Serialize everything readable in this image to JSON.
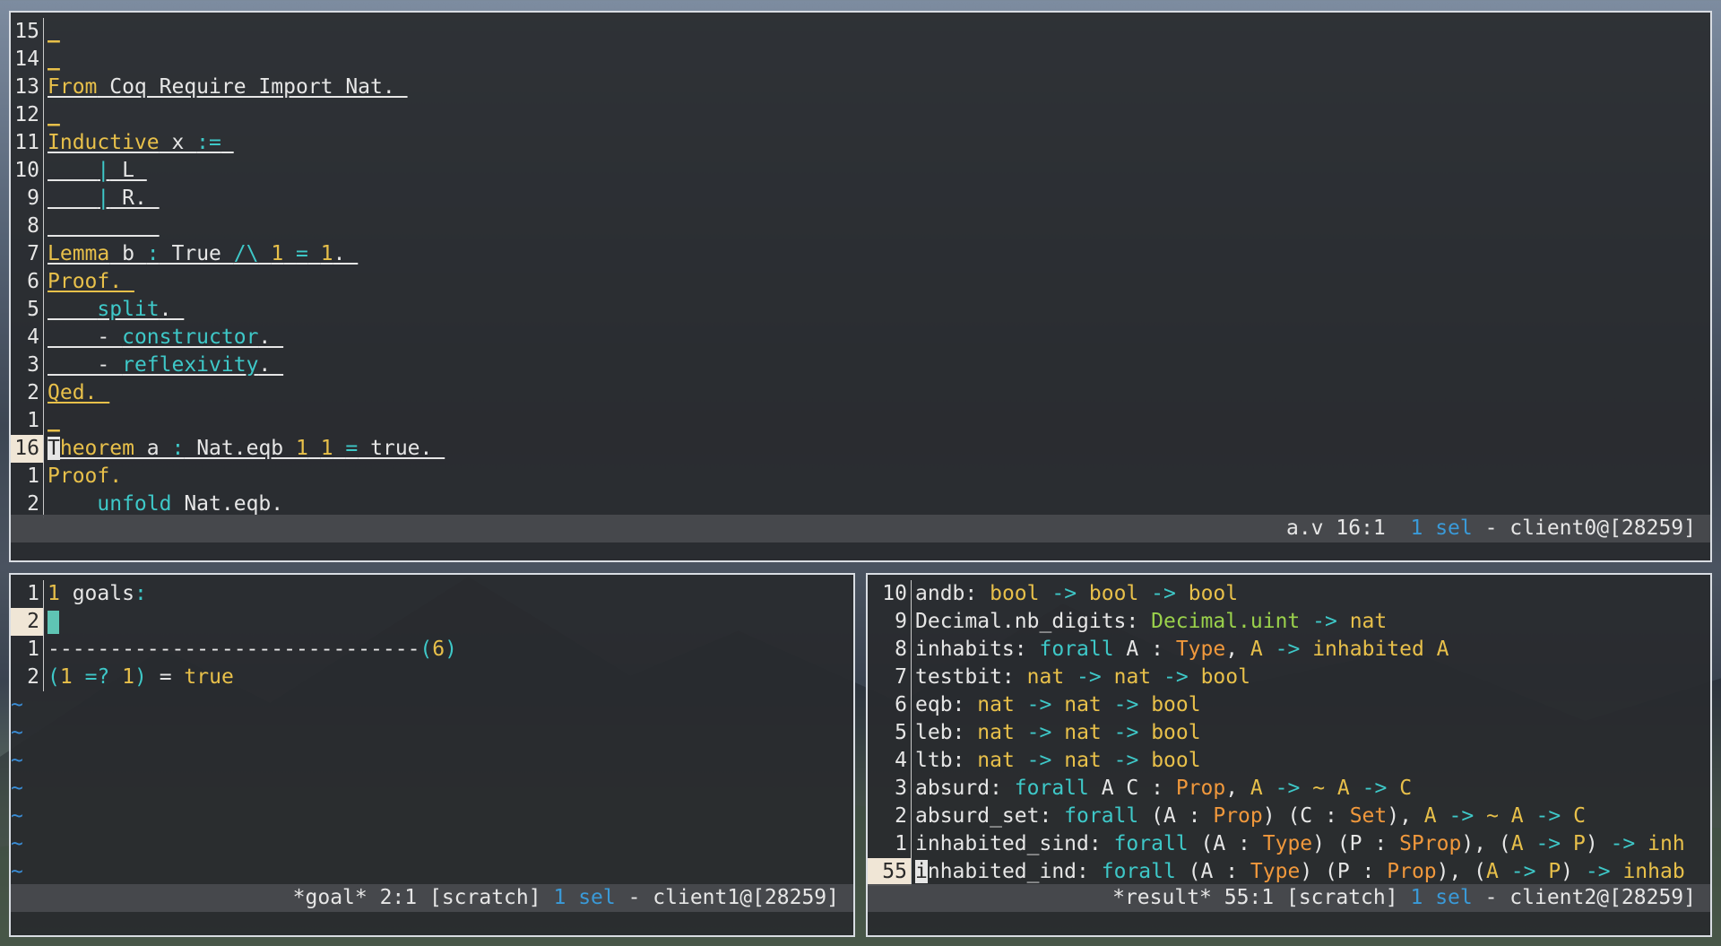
{
  "editor": {
    "lines": [
      {
        "num": "15",
        "text": "_"
      },
      {
        "num": "14",
        "text": "_"
      },
      {
        "num": "13",
        "text": "From Coq Require Import Nat."
      },
      {
        "num": "12",
        "text": "_"
      },
      {
        "num": "11",
        "text": "Inductive x :="
      },
      {
        "num": "10",
        "text": "    | L"
      },
      {
        "num": "9",
        "text": "    | R."
      },
      {
        "num": "8",
        "text": ""
      },
      {
        "num": "7",
        "text": "Lemma b : True /\\ 1 = 1."
      },
      {
        "num": "6",
        "text": "Proof."
      },
      {
        "num": "5",
        "text": "    split."
      },
      {
        "num": "4",
        "text": "    - constructor."
      },
      {
        "num": "3",
        "text": "    - reflexivity."
      },
      {
        "num": "2",
        "text": "Qed."
      },
      {
        "num": "1",
        "text": "_"
      },
      {
        "num": "16",
        "text": "Theorem a : Nat.eqb 1 1 = true."
      },
      {
        "num": "1",
        "text": "Proof."
      },
      {
        "num": "2",
        "text": "    unfold Nat.eqb."
      }
    ],
    "status": {
      "file": "a.v 16:1",
      "sel_count": "1",
      "sel_word": "sel",
      "client": "- client0@[28259]"
    }
  },
  "goal": {
    "lines": [
      {
        "num": "1",
        "text": "1 goals:"
      },
      {
        "num": "2",
        "text": ""
      },
      {
        "num": "1",
        "text": "------------------------------(6)"
      },
      {
        "num": "2",
        "text": "(1 =? 1) = true"
      }
    ],
    "tilde": "~",
    "status": {
      "file": "*goal* 2:1 [scratch]",
      "sel_count": "1",
      "sel_word": "sel",
      "client": "- client1@[28259]"
    }
  },
  "result": {
    "lines": [
      {
        "num": "10",
        "text": "andb: bool -> bool -> bool"
      },
      {
        "num": "9",
        "text": "Decimal.nb_digits: Decimal.uint -> nat"
      },
      {
        "num": "8",
        "text": "inhabits: forall A : Type, A -> inhabited A"
      },
      {
        "num": "7",
        "text": "testbit: nat -> nat -> bool"
      },
      {
        "num": "6",
        "text": "eqb: nat -> nat -> bool"
      },
      {
        "num": "5",
        "text": "leb: nat -> nat -> bool"
      },
      {
        "num": "4",
        "text": "ltb: nat -> nat -> bool"
      },
      {
        "num": "3",
        "text": "absurd: forall A C : Prop, A -> ~ A -> C"
      },
      {
        "num": "2",
        "text": "absurd_set: forall (A : Prop) (C : Set), A -> ~ A -> C"
      },
      {
        "num": "1",
        "text": "inhabited_sind: forall (A : Type) (P : SProp), (A -> P) -> inh"
      },
      {
        "num": "55",
        "text": "inhabited_ind: forall (A : Type) (P : Prop), (A -> P) -> inhab"
      }
    ],
    "status": {
      "file": "*result* 55:1 [scratch]",
      "sel_count": "1",
      "sel_word": "sel",
      "client": "- client2@[28259]"
    }
  }
}
